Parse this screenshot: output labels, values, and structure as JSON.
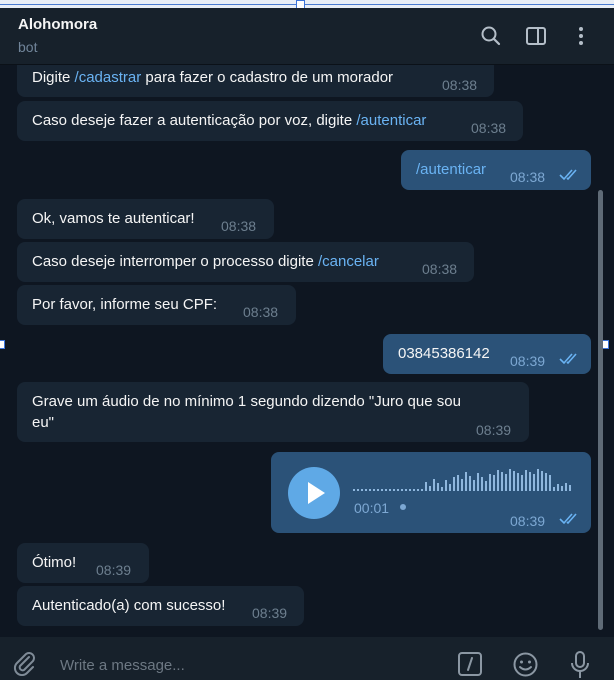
{
  "header": {
    "title": "Alohomora",
    "subtitle": "bot"
  },
  "messages": [
    {
      "parts": [
        "Digite ",
        "/cadastrar",
        " para fazer o cadastro de um morador"
      ],
      "time": "08:38"
    },
    {
      "parts": [
        "Caso deseje fazer a autenticação por voz, digite ",
        "/autenticar"
      ],
      "time": "08:38"
    },
    {
      "text": "/autenticar",
      "time": "08:38"
    },
    {
      "text": "Ok, vamos te autenticar!",
      "time": "08:38"
    },
    {
      "parts": [
        "Caso deseje interromper o processo digite ",
        "/cancelar"
      ],
      "time": "08:38"
    },
    {
      "text": "Por favor, informe seu CPF:",
      "time": "08:38"
    },
    {
      "text": "03845386142",
      "time": "08:39"
    },
    {
      "line1": "Grave um áudio de no mínimo 1 segundo dizendo \"Juro que sou",
      "line2": "eu\"",
      "time": "08:39"
    },
    {
      "voice_duration": "00:01",
      "time": "08:39"
    },
    {
      "text": "Ótimo!",
      "time": "08:39"
    },
    {
      "text": "Autenticado(a) com sucesso!",
      "time": "08:39"
    }
  ],
  "composer": {
    "placeholder": "Write a message..."
  },
  "icons": {
    "search": "search-icon",
    "sidebar": "sidebar-toggle-icon",
    "menu": "more-vertical-icon",
    "attach": "paperclip-icon",
    "commands": "bot-commands-icon",
    "emoji": "emoji-icon",
    "mic": "microphone-icon",
    "play": "play-icon",
    "read": "double-check-icon"
  },
  "colors": {
    "background": "#0e1621",
    "incoming": "#182533",
    "outgoing": "#2b5278",
    "link": "#6ab3f3"
  }
}
